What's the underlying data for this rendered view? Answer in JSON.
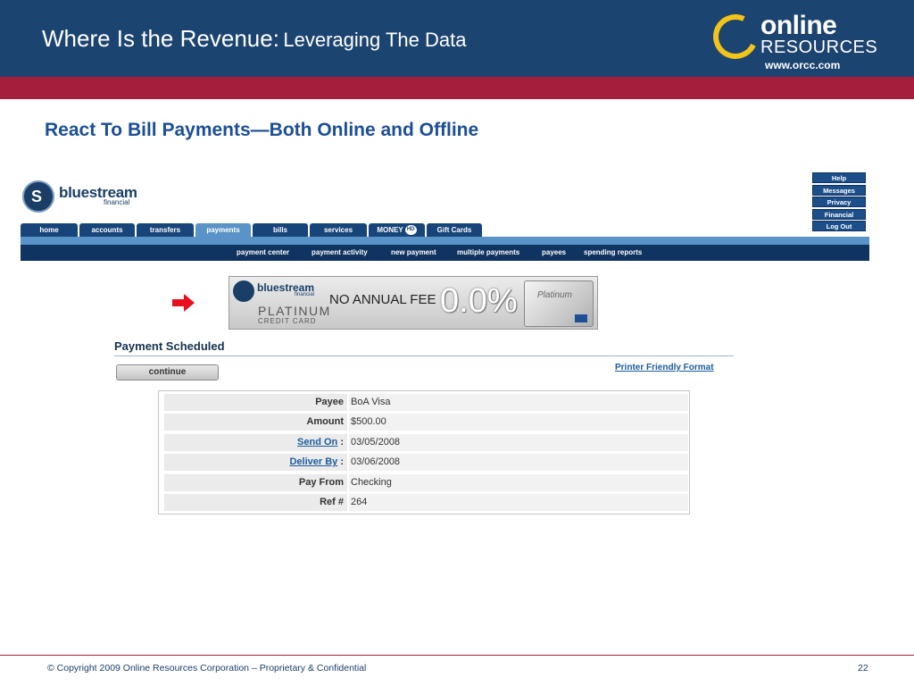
{
  "header": {
    "title": "Where Is the Revenue",
    "colon": ":",
    "subtitle": "Leveraging The Data",
    "logo_word1": "online",
    "logo_word2": "RESOURCES",
    "logo_url": "www.orcc.com"
  },
  "slide_subtitle": "React To Bill Payments—Both Online and Offline",
  "bank": {
    "logo_name": "bluestream",
    "logo_sub": "financial",
    "side_links": [
      "Help",
      "Messages",
      "Privacy",
      "Financial",
      "Log Out"
    ],
    "tabs": [
      {
        "label": "home"
      },
      {
        "label": "accounts"
      },
      {
        "label": "transfers"
      },
      {
        "label": "payments",
        "active": true
      },
      {
        "label": "bills"
      },
      {
        "label": "services"
      },
      {
        "label": "MONEY",
        "badge": "HD"
      },
      {
        "label": "Gift Cards"
      }
    ],
    "subnav": [
      "payment center",
      "payment activity",
      "new payment",
      "multiple payments",
      "payees",
      "spending reports"
    ]
  },
  "banner": {
    "brand": "bluestream",
    "brand_sub": "financial",
    "product": "PLATINUM",
    "product_sub": "CREDIT CARD",
    "fee_text": "NO ANNUAL FEE",
    "rate": "0.0%",
    "card_text": "Platinum"
  },
  "payment": {
    "title": "Payment Scheduled",
    "continue_label": "continue",
    "printer_link": "Printer Friendly Format",
    "rows": [
      {
        "label": "Payee",
        "value": "BoA Visa"
      },
      {
        "label": "Amount",
        "value": "$500.00"
      },
      {
        "label": "Send On",
        "suffix": ":",
        "value": "03/05/2008"
      },
      {
        "label": "Deliver By",
        "suffix": ":",
        "value": "03/06/2008"
      },
      {
        "label": "Pay From",
        "value": "Checking"
      },
      {
        "label": "Ref #",
        "value": "264"
      }
    ]
  },
  "footer": {
    "copyright": "© Copyright 2009 Online Resources Corporation – Proprietary & Confidential",
    "page_number": "22"
  },
  "colors": {
    "header_blue": "#1c4470",
    "accent_red": "#a51e3c",
    "subtitle_blue": "#1c4f96",
    "logo_yellow": "#f2c318",
    "nav_dark": "#0f3461",
    "tab_active": "#5a93c7",
    "arrow_red": "#e8101e"
  }
}
